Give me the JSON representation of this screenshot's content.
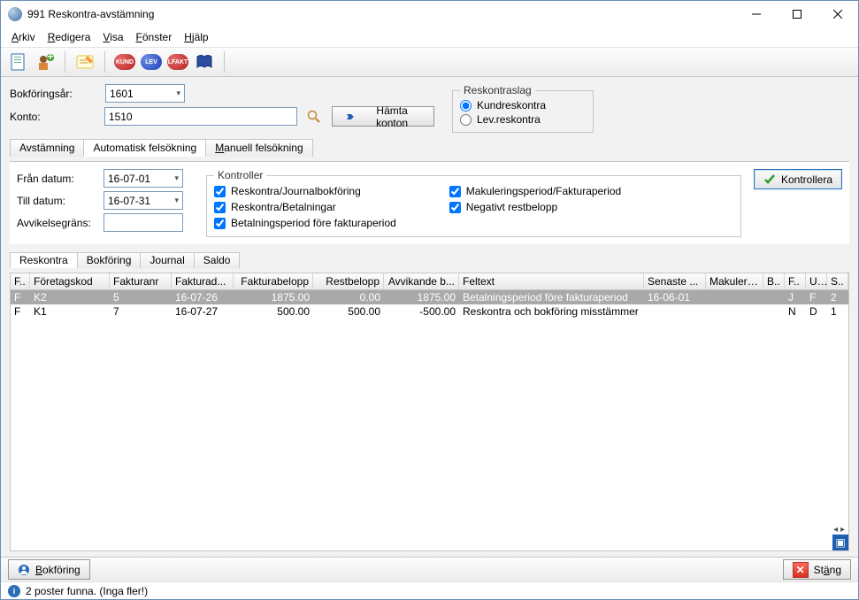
{
  "window": {
    "title": "991 Reskontra-avstämning"
  },
  "menu": {
    "arkiv": "Arkiv",
    "redigera": "Redigera",
    "visa": "Visa",
    "fonster": "Fönster",
    "hjalp": "Hjälp"
  },
  "toolbar_badges": {
    "kund": "KUND",
    "lev": "LEV",
    "lfakt": "LFAKT"
  },
  "top_form": {
    "bokforingsar_label": "Bokföringsår:",
    "bokforingsar_value": "1601",
    "konto_label": "Konto:",
    "konto_value": "1510",
    "hamta_konton": "Hämta konton",
    "reskontraslag_legend": "Reskontraslag",
    "kundreskontra_label": "Kundreskontra",
    "levreskontra_label": "Lev.reskontra"
  },
  "tabs": {
    "avstamning": "Avstämning",
    "autofel": "Automatisk felsökning",
    "manfel": "Manuell felsökning"
  },
  "autofel": {
    "fran_label": "Från datum:",
    "fran_value": "16-07-01",
    "till_label": "Till datum:",
    "till_value": "16-07-31",
    "avvik_label": "Avvikelsegräns:",
    "avvik_value": "",
    "kontroller_legend": "Kontroller",
    "chk1": "Reskontra/Journalbokföring",
    "chk2": "Reskontra/Betalningar",
    "chk3": "Betalningsperiod före fakturaperiod",
    "chk4": "Makuleringsperiod/Fakturaperiod",
    "chk5": "Negativt restbelopp",
    "kontrollera_btn": "Kontrollera"
  },
  "subtabs": {
    "reskontra": "Reskontra",
    "bokforing": "Bokföring",
    "journal": "Journal",
    "saldo": "Saldo"
  },
  "grid": {
    "headers": {
      "f": "F..",
      "foretagskod": "Företagskod",
      "fakturanr": "Fakturanr",
      "fakturad": "Fakturad...",
      "fakturabelopp": "Fakturabelopp",
      "restbelopp": "Restbelopp",
      "avvikande": "Avvikande b...",
      "feltext": "Feltext",
      "senaste": "Senaste ...",
      "makulera": "Makulera...",
      "b": "B..",
      "f2": "F..",
      "u": "U..",
      "s": "S.."
    },
    "rows": [
      {
        "f": "F",
        "foretagskod": "K2",
        "fakturanr": "5",
        "fakturad": "16-07-26",
        "fakturabelopp": "1875.00",
        "restbelopp": "0.00",
        "avvikande": "1875.00",
        "feltext": "Betalningsperiod före fakturaperiod",
        "senaste": "16-06-01",
        "makulera": "",
        "b": "",
        "f2": "J",
        "u": "F",
        "s": "2"
      },
      {
        "f": "F",
        "foretagskod": "K1",
        "fakturanr": "7",
        "fakturad": "16-07-27",
        "fakturabelopp": "500.00",
        "restbelopp": "500.00",
        "avvikande": "-500.00",
        "feltext": "Reskontra och bokföring misstämmer",
        "senaste": "",
        "makulera": "",
        "b": "",
        "f2": "N",
        "u": "D",
        "s": "1"
      }
    ]
  },
  "bottom": {
    "bokforing": "Bokföring",
    "stang": "Stäng"
  },
  "status": {
    "text": "2 poster funna. (Inga fler!)"
  }
}
